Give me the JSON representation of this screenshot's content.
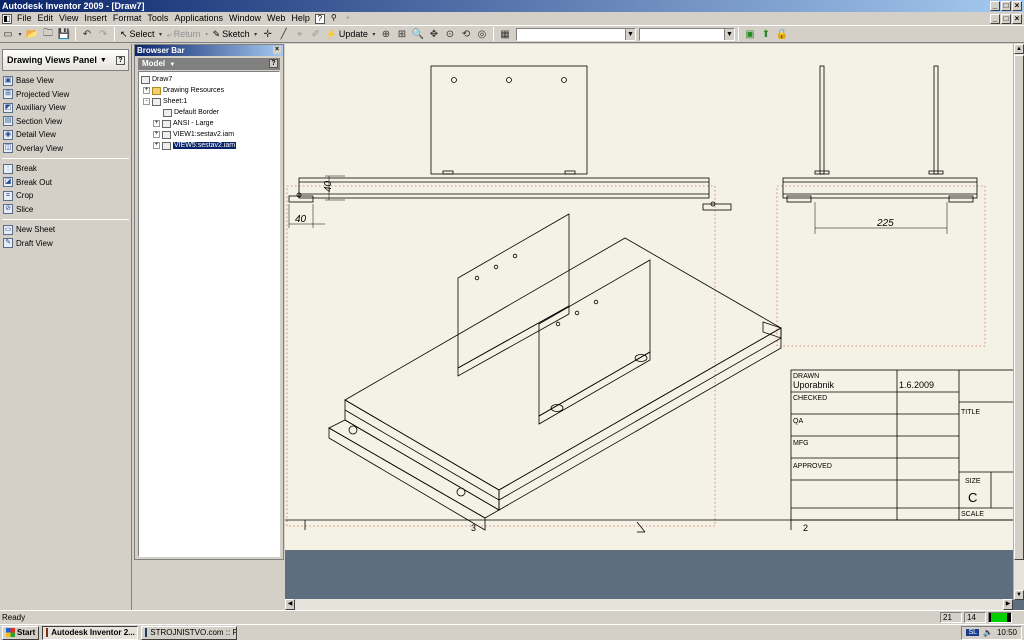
{
  "window": {
    "title": "Autodesk Inventor 2009 - [Draw7]",
    "controls": [
      "_",
      "□",
      "×"
    ]
  },
  "menu": {
    "items": [
      "File",
      "Edit",
      "View",
      "Insert",
      "Format",
      "Tools",
      "Applications",
      "Window",
      "Web",
      "Help"
    ]
  },
  "toolbar": {
    "select_label": "Select",
    "return_label": "Return",
    "sketch_label": "Sketch",
    "update_label": "Update",
    "combo1_value": "",
    "combo2_value": ""
  },
  "left_panel": {
    "title": "Drawing Views Panel",
    "group1": [
      {
        "label": "Base View",
        "icon": "base-view-icon"
      },
      {
        "label": "Projected View",
        "icon": "projected-view-icon"
      },
      {
        "label": "Auxiliary View",
        "icon": "auxiliary-view-icon"
      },
      {
        "label": "Section View",
        "icon": "section-view-icon"
      },
      {
        "label": "Detail View",
        "icon": "detail-view-icon"
      },
      {
        "label": "Overlay View",
        "icon": "overlay-view-icon"
      }
    ],
    "group2": [
      {
        "label": "Break",
        "icon": "break-icon"
      },
      {
        "label": "Break Out",
        "icon": "break-out-icon"
      },
      {
        "label": "Crop",
        "icon": "crop-icon"
      },
      {
        "label": "Slice",
        "icon": "slice-icon"
      }
    ],
    "group3": [
      {
        "label": "New Sheet",
        "icon": "new-sheet-icon"
      },
      {
        "label": "Draft View",
        "icon": "draft-view-icon"
      }
    ]
  },
  "browser": {
    "title": "Browser Bar",
    "mode": "Model",
    "tree": [
      {
        "label": "Draw7",
        "level": 0,
        "expander": ""
      },
      {
        "label": "Drawing Resources",
        "level": 1,
        "expander": "+"
      },
      {
        "label": "Sheet:1",
        "level": 1,
        "expander": "-"
      },
      {
        "label": "Default Border",
        "level": 2,
        "expander": ""
      },
      {
        "label": "ANSI - Large",
        "level": 2,
        "expander": "+"
      },
      {
        "label": "VIEW1:sestav2.iam",
        "level": 2,
        "expander": "+"
      },
      {
        "label": "VIEW5:sestav2.iam",
        "level": 2,
        "expander": "+",
        "selected": true
      }
    ]
  },
  "drawing": {
    "dim_40_vertical": "40",
    "dim_40_horizontal": "40",
    "dim_225": "225",
    "zone_3": "3",
    "zone_2": "2",
    "title_block": {
      "drawn_label": "DRAWN",
      "drawn_by": "Uporabnik",
      "drawn_date": "1.6.2009",
      "checked_label": "CHECKED",
      "qa_label": "QA",
      "mfg_label": "MFG",
      "approved_label": "APPROVED",
      "title_label": "TITLE",
      "size_label": "SIZE",
      "size_value": "C",
      "scale_label": "SCALE"
    }
  },
  "status": {
    "text": "Ready",
    "field1": "21",
    "field2": "14"
  },
  "taskbar": {
    "start": "Start",
    "tasks": [
      {
        "label": "Autodesk Inventor 2...",
        "active": true
      },
      {
        "label": "STROJNISTVO.com :: Po...",
        "active": false
      }
    ],
    "lang": "SL",
    "clock": "10:50"
  },
  "colors": {
    "titlebar_start": "#0a246a",
    "sheet_bg": "#f4f2e4",
    "workspace_bg": "#5e6e7e"
  }
}
